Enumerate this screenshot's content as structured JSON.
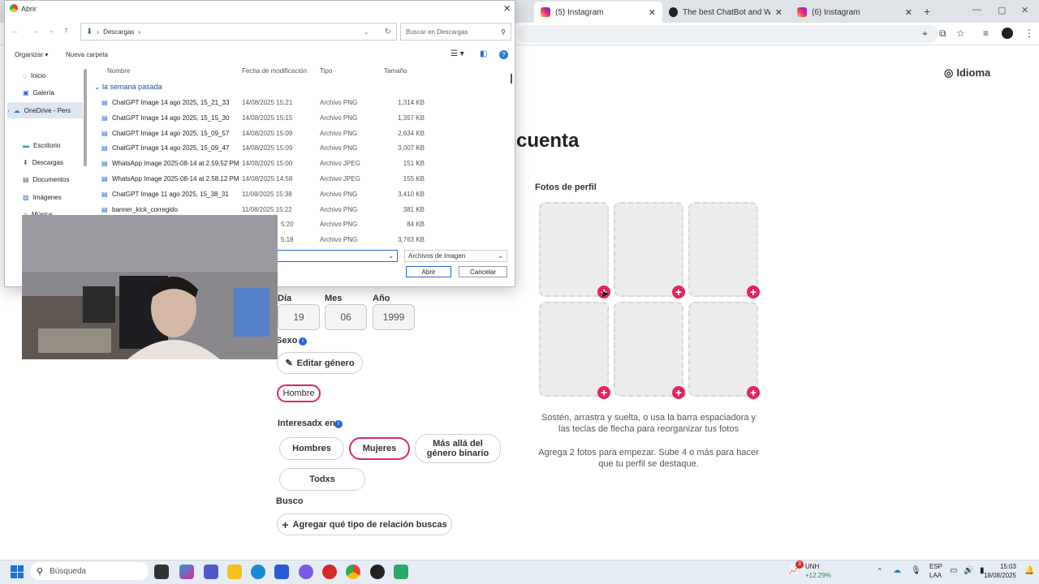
{
  "browser": {
    "tabs": [
      {
        "label": "(5) Instagram"
      },
      {
        "label": "The best ChatBot and Widgets"
      },
      {
        "label": "(6) Instagram"
      }
    ],
    "new_tab": "+"
  },
  "page": {
    "language_label": "Idioma",
    "heading": "cuenta",
    "photos_label": "Fotos de perfil",
    "photo_hint": "Sostén, arrastra y suelta, o usa la barra espaciadora y las teclas de flecha para reorganizar tus fotos",
    "photo_hint2": "Agrega 2 fotos para empezar. Sube 4 o más para hacer que tu perfil se destaque.",
    "birth": {
      "day_label": "Día",
      "month_label": "Mes",
      "year_label": "Año",
      "day": "19",
      "month": "06",
      "year": "1999"
    },
    "sex_label": "Sexo",
    "edit_gender": "Editar género",
    "gender_value": "Hombre",
    "interested_label": "Interesadx en",
    "interest_options": [
      "Hombres",
      "Mujeres",
      "Más allá del género binario",
      "Todxs"
    ],
    "seeking_label": "Busco",
    "seeking_button": "Agregar qué tipo de relación buscas"
  },
  "dialog": {
    "title": "Abrir",
    "breadcrumb": "Descargas",
    "search_placeholder": "Buscar en Descargas",
    "organize": "Organizar",
    "new_folder": "Nueva carpeta",
    "nav": [
      "Inicio",
      "Galería",
      "OneDrive - Pers",
      "Escritorio",
      "Descargas",
      "Documentos",
      "Imágenes",
      "Música"
    ],
    "columns": {
      "name": "Nombre",
      "date": "Fecha de modificación",
      "type": "Tipo",
      "size": "Tamaño"
    },
    "group": "la semana pasada",
    "files": [
      {
        "name": "ChatGPT Image 14 ago 2025, 15_21_33",
        "date": "14/08/2025 15:21",
        "type": "Archivo PNG",
        "size": "1,314 KB"
      },
      {
        "name": "ChatGPT Image 14 ago 2025, 15_15_30",
        "date": "14/08/2025 15:15",
        "type": "Archivo PNG",
        "size": "1,357 KB"
      },
      {
        "name": "ChatGPT Image 14 ago 2025, 15_09_57",
        "date": "14/08/2025 15:09",
        "type": "Archivo PNG",
        "size": "2,634 KB"
      },
      {
        "name": "ChatGPT Image 14 ago 2025, 15_09_47",
        "date": "14/08/2025 15:09",
        "type": "Archivo PNG",
        "size": "3,007 KB"
      },
      {
        "name": "WhatsApp Image 2025-08-14 at 2.59.52 PM",
        "date": "14/08/2025 15:00",
        "type": "Archivo JPEG",
        "size": "151 KB"
      },
      {
        "name": "WhatsApp Image 2025-08-14 at 2.58.12 PM",
        "date": "14/08/2025 14:58",
        "type": "Archivo JPEG",
        "size": "155 KB"
      },
      {
        "name": "ChatGPT Image 11 ago 2025, 15_38_31",
        "date": "11/08/2025 15:38",
        "type": "Archivo PNG",
        "size": "3,410 KB"
      },
      {
        "name": "banner_kick_corregido",
        "date": "11/08/2025 15:22",
        "type": "Archivo PNG",
        "size": "381 KB"
      },
      {
        "name": "",
        "date": "5:20",
        "type": "Archivo PNG",
        "size": "84 KB"
      },
      {
        "name": "",
        "date": "5:18",
        "type": "Archivo PNG",
        "size": "3,763 KB"
      }
    ],
    "filter": "Archivos de imagen",
    "open_button": "Abrir",
    "cancel_button": "Cancelar"
  },
  "taskbar": {
    "search_placeholder": "Búsqueda",
    "stock": {
      "name": "UNH",
      "change": "+12.29%",
      "badge": "3"
    },
    "lang": "ESP",
    "layout": "LAA",
    "time": "15:03",
    "date": "18/08/2025"
  }
}
